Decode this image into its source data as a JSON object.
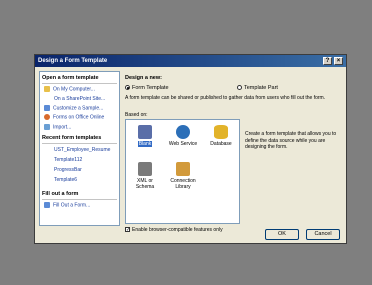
{
  "window": {
    "title": "Design a Form Template",
    "help_label": "?",
    "close_label": "×"
  },
  "left": {
    "open_heading": "Open a form template",
    "open_links": [
      "On My Computer...",
      "On a SharePoint Site...",
      "Customize a Sample...",
      "Forms on Office Online",
      "Import..."
    ],
    "recent_heading": "Recent form templates",
    "recent_items": [
      "UST_Employee_Resume",
      "Template112",
      "ProgressBar",
      "Template6"
    ],
    "fill_heading": "Fill out a form",
    "fill_links": [
      "Fill Out a Form..."
    ]
  },
  "right": {
    "design_heading": "Design a new:",
    "radio_form_template": "Form Template",
    "radio_template_part": "Template Part",
    "intro": "A form template can be shared or published to gather data from users who fill out the form.",
    "based_on_label": "Based on:",
    "tiles": [
      "Blank",
      "Web Service",
      "Database",
      "XML or Schema",
      "Connection Library"
    ],
    "selected_tile": "Blank",
    "description": "Create a form template that allows you to define the data source while you are designing the form.",
    "checkbox_label": "Enable browser-compatible features only"
  },
  "buttons": {
    "ok": "OK",
    "cancel": "Cancel"
  },
  "colors": {
    "title_start": "#0a246a",
    "title_end": "#3a6ea5",
    "link": "#1b3e9c",
    "selection": "#316ac5",
    "dialog_bg": "#ece9d8",
    "backdrop": "#7f7f7f"
  }
}
